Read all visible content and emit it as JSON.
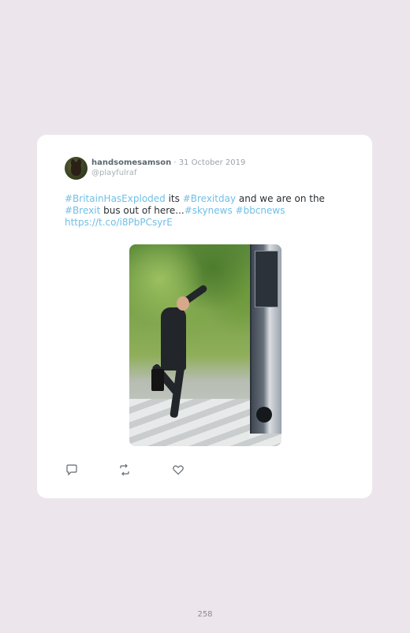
{
  "tweet": {
    "author_name": "handsomesamson",
    "separator": " · ",
    "date": "31 October 2019",
    "handle": "@playfulraf",
    "text_parts": {
      "h1": "#BritainHasExploded",
      "t1": " its ",
      "h2": "#Brexitday",
      "t2": " and we are on the ",
      "h3": "#Brexit",
      "t3": " bus out of here...",
      "h4": "#skynews",
      "t4": " ",
      "h5": "#bbcnews",
      "link": "https://t.co/i8PbPCsyrE"
    }
  },
  "actions": {
    "reply_icon": "reply-icon",
    "retweet_icon": "retweet-icon",
    "like_icon": "heart-icon"
  },
  "colors": {
    "hashtag": "#6fbfe6",
    "background": "#ece6ec",
    "card": "#ffffff"
  },
  "page_number": "258"
}
